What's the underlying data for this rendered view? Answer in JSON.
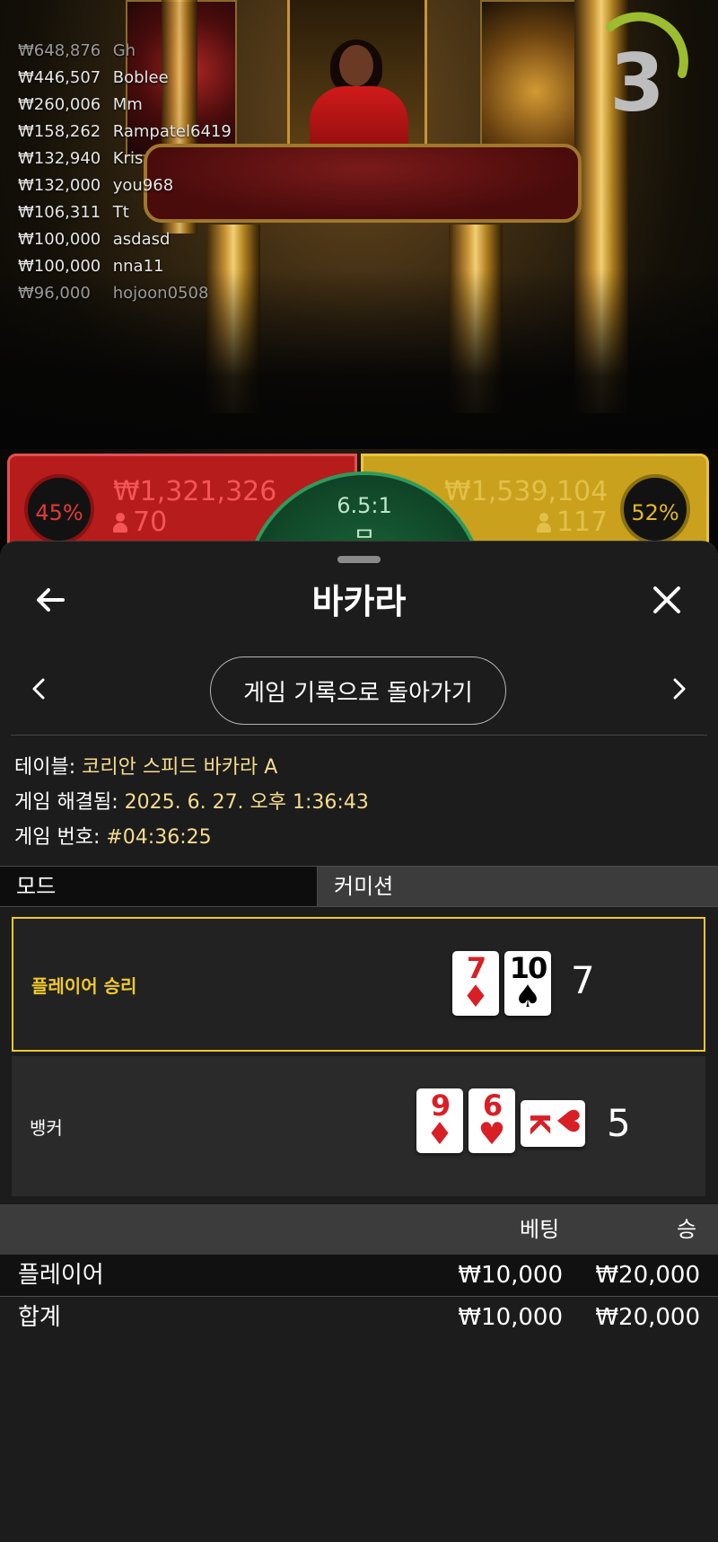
{
  "stage": {
    "leaderboard": [
      {
        "amount": "₩648,876",
        "name": "Gh"
      },
      {
        "amount": "₩446,507",
        "name": "Boblee"
      },
      {
        "amount": "₩260,006",
        "name": "Mm"
      },
      {
        "amount": "₩158,262",
        "name": "Rampatel6419"
      },
      {
        "amount": "₩132,940",
        "name": "Kris"
      },
      {
        "amount": "₩132,000",
        "name": "you968"
      },
      {
        "amount": "₩106,311",
        "name": "Tt"
      },
      {
        "amount": "₩100,000",
        "name": "asdasd"
      },
      {
        "amount": "₩100,000",
        "name": "nna11"
      },
      {
        "amount": "₩96,000",
        "name": "hojoon0508"
      }
    ],
    "countdown": "3"
  },
  "bets": {
    "player": {
      "percent": "45%",
      "amount": "₩1,321,326",
      "count": "70",
      "color": "#b71c1c"
    },
    "banker": {
      "percent": "52%",
      "amount": "₩1,539,104",
      "count": "117",
      "color": "#c9a11c"
    },
    "tie": {
      "odds": "6.5:1",
      "label": "무",
      "color": "#1d6a3d"
    }
  },
  "sheet": {
    "title": "바카라",
    "back_icon": "arrow-left-icon",
    "close_icon": "close-icon",
    "return_button": "게임 기록으로 돌아가기",
    "info": {
      "table_label": "테이블:",
      "table_value": "코리안 스피드 바카라 A",
      "resolved_label": "게임 해결됨:",
      "resolved_value": "2025. 6. 27. 오후 1:36:43",
      "round_label": "게임 번호:",
      "round_value": "#04:36:25"
    },
    "mode_label": "모드",
    "commission_label": "커미션",
    "results": {
      "player": {
        "label": "플레이어 승리",
        "score": "7",
        "cards": [
          {
            "rank": "7",
            "suit": "♦",
            "color": "red"
          },
          {
            "rank": "10",
            "suit": "♠",
            "color": "black"
          }
        ]
      },
      "banker": {
        "label": "뱅커",
        "score": "5",
        "cards": [
          {
            "rank": "9",
            "suit": "♦",
            "color": "red"
          },
          {
            "rank": "6",
            "suit": "♥",
            "color": "red"
          },
          {
            "rank": "K",
            "suit": "♥",
            "color": "red"
          }
        ]
      }
    },
    "bet_table": {
      "headers": [
        "베팅",
        "승"
      ],
      "rows": [
        {
          "label": "플레이어",
          "bet": "₩10,000",
          "win": "₩20,000"
        },
        {
          "label": "합계",
          "bet": "₩10,000",
          "win": "₩20,000"
        }
      ]
    },
    "accent_color": "#f0c92b"
  }
}
